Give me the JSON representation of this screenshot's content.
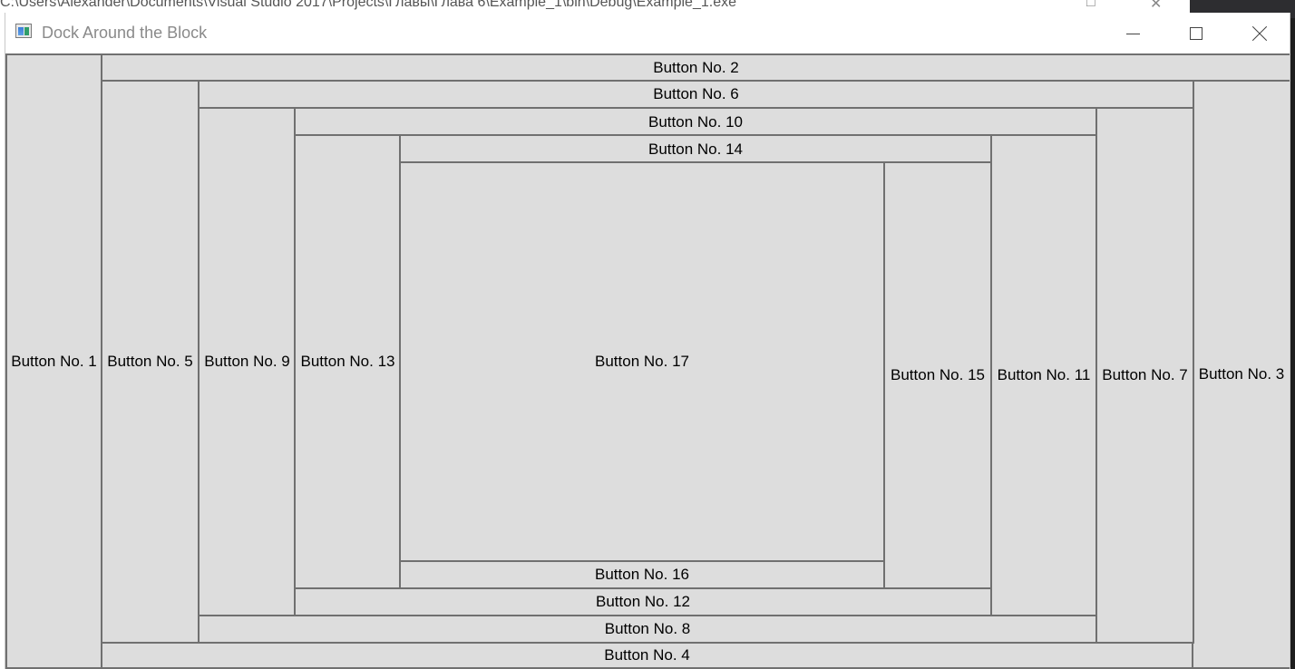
{
  "background_window": {
    "title": "C:\\Users\\Alexander\\Documents\\Visual Studio 2017\\Projects\\Главы\\Глава 6\\Example_1\\bin\\Debug\\Example_1.exe"
  },
  "window": {
    "title": "Dock Around the Block",
    "icon": "window-app-icon",
    "controls": {
      "minimize": "minimize-icon",
      "maximize": "maximize-icon",
      "close": "close-icon"
    }
  },
  "buttons": {
    "b1": "Button No. 1",
    "b2": "Button No. 2",
    "b3": "Button No. 3",
    "b4": "Button No. 4",
    "b5": "Button No. 5",
    "b6": "Button No. 6",
    "b7": "Button No. 7",
    "b8": "Button No. 8",
    "b9": "Button No. 9",
    "b10": "Button No. 10",
    "b11": "Button No. 11",
    "b12": "Button No. 12",
    "b13": "Button No. 13",
    "b14": "Button No. 14",
    "b15": "Button No. 15",
    "b16": "Button No. 16",
    "b17": "Button No. 17"
  },
  "colors": {
    "button_face": "#dddddd",
    "button_border": "#707070",
    "title_text": "#8a8a8a"
  }
}
